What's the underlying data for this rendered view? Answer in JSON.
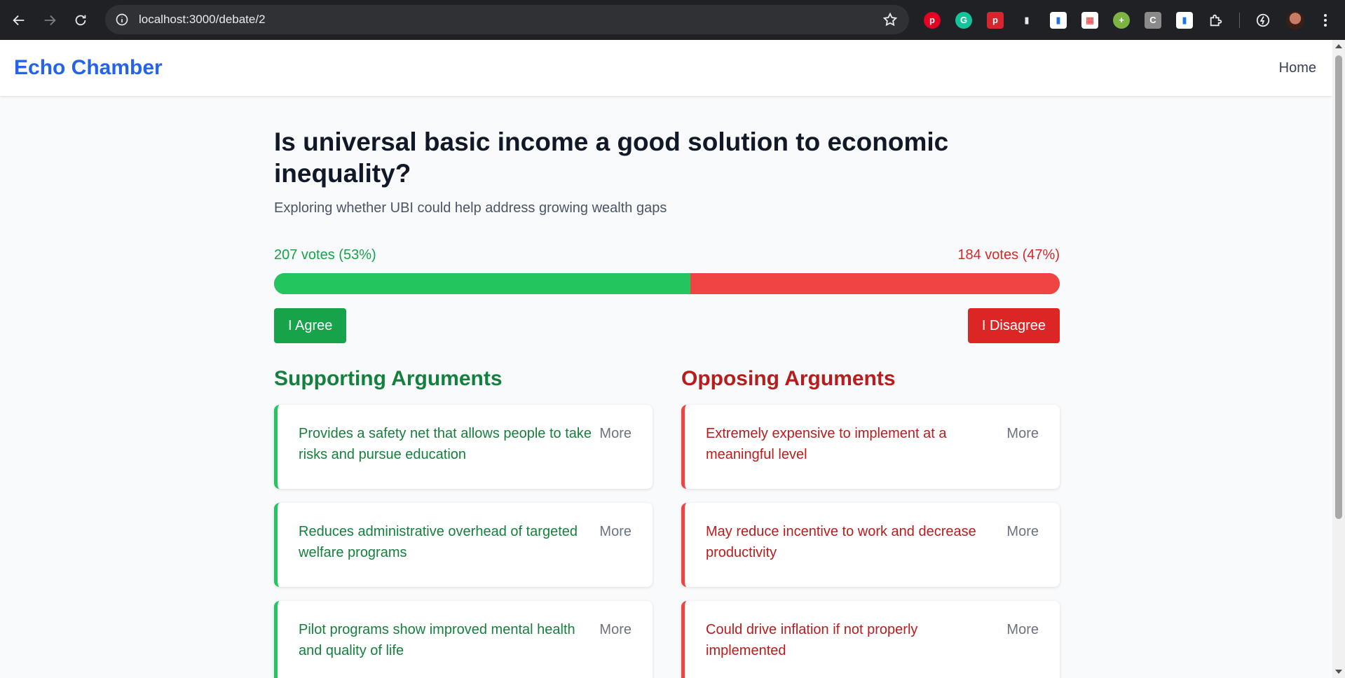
{
  "browser": {
    "url": "localhost:3000/debate/2"
  },
  "header": {
    "brand": "Echo Chamber",
    "home_label": "Home"
  },
  "debate": {
    "question": "Is universal basic income a good solution to economic inequality?",
    "description": "Exploring whether UBI could help address growing wealth gaps",
    "agree_votes_text": "207 votes (53%)",
    "disagree_votes_text": "184 votes (47%)",
    "agree_fraction": 0.53,
    "agree_button": "I Agree",
    "disagree_button": "I Disagree"
  },
  "supporting": {
    "title": "Supporting Arguments",
    "items": [
      {
        "text": "Provides a safety net that allows people to take risks and pursue education",
        "more": "More"
      },
      {
        "text": "Reduces administrative overhead of targeted welfare programs",
        "more": "More"
      },
      {
        "text": "Pilot programs show improved mental health and quality of life",
        "more": "More"
      }
    ]
  },
  "opposing": {
    "title": "Opposing Arguments",
    "items": [
      {
        "text": "Extremely expensive to implement at a meaningful level",
        "more": "More"
      },
      {
        "text": "May reduce incentive to work and decrease productivity",
        "more": "More"
      },
      {
        "text": "Could drive inflation if not properly implemented",
        "more": "More"
      }
    ]
  },
  "colors": {
    "brand": "#2563eb",
    "agree": "#22c55e",
    "disagree": "#ef4444"
  }
}
